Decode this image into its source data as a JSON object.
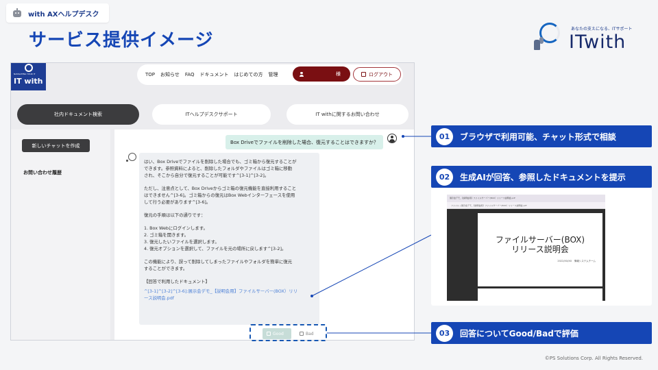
{
  "header": {
    "tag_label": "with AXヘルプデスク",
    "page_title": "サービス提供イメージ",
    "brand_tagline": "あなたの支えになる、ITサポート",
    "brand_name": "ITwith"
  },
  "app": {
    "logo_sub": "NAVIGATING YOUR IT",
    "logo_name": "IT with",
    "nav": [
      "TOP",
      "お知らせ",
      "FAQ",
      "ドキュメント",
      "はじめての方",
      "管理"
    ],
    "user_suffix": "様",
    "logout_label": "ログアウト",
    "tabs": [
      "社内ドキュメント検索",
      "ITヘルプデスクサポート",
      "IT withに関するお問い合わせ"
    ],
    "sidebar": {
      "new_chat_label": "新しいチャットを作成",
      "history_label": "お問い合わせ履歴"
    },
    "chat": {
      "user_question": "Box Driveでファイルを削除した場合、復元することはできますか？",
      "answer_paragraphs": [
        "はい、Box Driveでファイルを削除した場合でも、ゴミ箱から復元することが\nできます。参照資料によると、削除したフォルダやファイルはゴミ箱に移動\nされ、そこから自分で復元することが可能です^[3-1]^[3-2]。",
        "ただし、注意点として、Box Driveからゴミ箱の復元機能を直接利用すること\nはできません^[3-6]。ゴミ箱からの復元はBox Webインターフェースを使用\nして行う必要があります^[3-6]。",
        "復元の手順は以下の通りです：",
        "1. Box Webにログインします。\n2. ゴミ箱を開きます。\n3. 復元したいファイルを選択します。\n4. 復元オプションを選択して、ファイルを元の場所に戻します^[3-2]。",
        "この機能により、誤って削除してしまったファイルやフォルダを簡単に復元\nすることができます。",
        "【回答で利用したドキュメント】"
      ],
      "answer_link": "^[3-1]^[3-2]^[3-6]:展示会デモ_【説明会用】ファイルサーバー(BOX）リリ\nース説明会.pdf",
      "good_label": "Good",
      "bad_label": "Bad"
    }
  },
  "callouts": [
    {
      "num": "01",
      "text": "ブラウザで利用可能、チャット形式で相談"
    },
    {
      "num": "02",
      "text": "生成AIが回答、参照したドキュメントを提示"
    },
    {
      "num": "03",
      "text": "回答についてGood/Badで評価"
    }
  ],
  "document_preview": {
    "tab_text": "展示会デモ_【説明会用】ファイルサーバー(BOX）リリース説明会.pdf",
    "address_text": "ファイル  |  展示会デモ_【説明会用】ファイルサーバー(BOX）リリース説明会.pdf",
    "title_line1": "ファイルサーバー(BOX)",
    "title_line2": "リリース説明会",
    "date_line": "2022/XX/XX　情報システムチーム"
  },
  "footer": {
    "copyright": "©PS Solutions Corp. All Rights Reserved."
  },
  "colors": {
    "primary_blue": "#1546b5",
    "logout_red": "#7a0f12",
    "question_bg": "#d8f0ea"
  }
}
